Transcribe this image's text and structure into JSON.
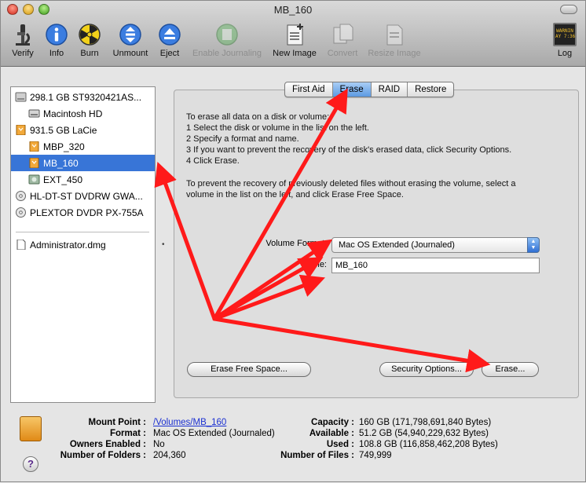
{
  "window": {
    "title": "MB_160"
  },
  "toolbar": {
    "items": [
      {
        "label": "Verify",
        "icon": "microscope-icon",
        "disabled": false
      },
      {
        "label": "Info",
        "icon": "info-icon",
        "disabled": false
      },
      {
        "label": "Burn",
        "icon": "burn-icon",
        "disabled": false
      },
      {
        "label": "Unmount",
        "icon": "unmount-icon",
        "disabled": false
      },
      {
        "label": "Eject",
        "icon": "eject-icon",
        "disabled": false
      },
      {
        "label": "Enable Journaling",
        "icon": "journaling-icon",
        "disabled": true
      },
      {
        "label": "New Image",
        "icon": "new-image-icon",
        "disabled": false
      },
      {
        "label": "Convert",
        "icon": "convert-icon",
        "disabled": true
      },
      {
        "label": "Resize Image",
        "icon": "resize-image-icon",
        "disabled": true
      },
      {
        "label": "Log",
        "icon": "log-icon",
        "disabled": false
      }
    ],
    "log_icon_text": "WARNIN\nAY 7:36"
  },
  "sidebar": {
    "devices": [
      {
        "label": "298.1 GB ST9320421AS...",
        "icon": "hard-disk-icon"
      },
      {
        "label": "Macintosh HD",
        "icon": "volume-icon"
      },
      {
        "label": "931.5 GB LaCie",
        "icon": "external-disk-icon"
      },
      {
        "label": "MBP_320",
        "icon": "external-volume-icon"
      },
      {
        "label": "MB_160",
        "icon": "external-volume-icon",
        "selected": true
      },
      {
        "label": "EXT_450",
        "icon": "external-volume-icon"
      },
      {
        "label": "HL-DT-ST DVDRW GWA...",
        "icon": "optical-drive-icon"
      },
      {
        "label": "PLEXTOR DVDR PX-755A",
        "icon": "optical-drive-icon"
      }
    ],
    "images": [
      {
        "label": "Administrator.dmg",
        "icon": "disk-image-icon"
      }
    ]
  },
  "tabs": [
    "First Aid",
    "Erase",
    "RAID",
    "Restore"
  ],
  "active_tab": "Erase",
  "erase": {
    "instructions": [
      "To erase all data on a disk or volume:",
      "1 Select the disk or volume in the list on the left.",
      "2 Specify a format and name.",
      "3 If you want to prevent the recovery of the disk's erased data, click Security Options.",
      "4 Click Erase."
    ],
    "free_space_note": [
      "To prevent the recovery of previously deleted files without erasing the volume, select a",
      "volume in the list on the left, and click Erase Free Space."
    ],
    "format_label": "Volume Format:",
    "format_value": "Mac OS Extended (Journaled)",
    "name_label": "Name:",
    "name_value": "MB_160",
    "erase_free_space_button": "Erase Free Space...",
    "security_options_button": "Security Options...",
    "erase_button": "Erase..."
  },
  "info": {
    "left": [
      {
        "label": "Mount Point :",
        "value": "/Volumes/MB_160",
        "link": true
      },
      {
        "label": "Format :",
        "value": "Mac OS Extended (Journaled)"
      },
      {
        "label": "Owners Enabled :",
        "value": "No"
      },
      {
        "label": "Number of Folders :",
        "value": "204,360"
      }
    ],
    "right": [
      {
        "label": "Capacity :",
        "value": "160 GB (171,798,691,840 Bytes)"
      },
      {
        "label": "Available :",
        "value": "51.2 GB (54,940,229,632 Bytes)"
      },
      {
        "label": "Used :",
        "value": "108.8 GB (116,858,462,208 Bytes)"
      },
      {
        "label": "Number of Files :",
        "value": "749,999"
      }
    ],
    "help_label": "?"
  },
  "annotation_color": "#ff1a1a"
}
